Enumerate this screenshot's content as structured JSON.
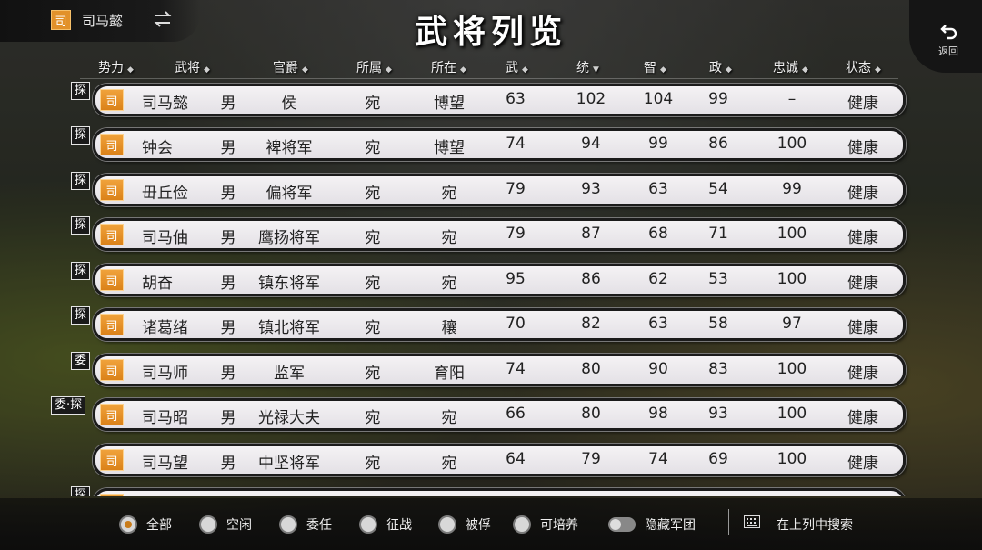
{
  "ruler": {
    "tag": "司",
    "name": "司马懿"
  },
  "title": "武将列览",
  "back_label": "返回",
  "header": {
    "columns": [
      {
        "label": "势力",
        "sort": "◆"
      },
      {
        "label": "武将",
        "sort": "◆"
      },
      {
        "label": "官爵",
        "sort": "◆"
      },
      {
        "label": "所属",
        "sort": "◆"
      },
      {
        "label": "所在",
        "sort": "◆"
      },
      {
        "label": "武",
        "sort": "◆"
      },
      {
        "label": "统",
        "sort": "▼"
      },
      {
        "label": "智",
        "sort": "◆"
      },
      {
        "label": "政",
        "sort": "◆"
      },
      {
        "label": "忠诚",
        "sort": "◆"
      },
      {
        "label": "状态",
        "sort": "◆"
      }
    ]
  },
  "rows": [
    {
      "badge": "探",
      "faction": "司",
      "name": "司马懿",
      "gender": "男",
      "rank": "侯",
      "belong": "宛",
      "location": "博望",
      "wu": "63",
      "tong": "102",
      "zhi": "104",
      "zheng": "99",
      "loyalty": "–",
      "status": "健康"
    },
    {
      "badge": "探",
      "faction": "司",
      "name": "钟会",
      "gender": "男",
      "rank": "裨将军",
      "belong": "宛",
      "location": "博望",
      "wu": "74",
      "tong": "94",
      "zhi": "99",
      "zheng": "86",
      "loyalty": "100",
      "status": "健康"
    },
    {
      "badge": "探",
      "faction": "司",
      "name": "毌丘俭",
      "gender": "男",
      "rank": "偏将军",
      "belong": "宛",
      "location": "宛",
      "wu": "79",
      "tong": "93",
      "zhi": "63",
      "zheng": "54",
      "loyalty": "99",
      "status": "健康"
    },
    {
      "badge": "探",
      "faction": "司",
      "name": "司马伷",
      "gender": "男",
      "rank": "鹰扬将军",
      "belong": "宛",
      "location": "宛",
      "wu": "79",
      "tong": "87",
      "zhi": "68",
      "zheng": "71",
      "loyalty": "100",
      "status": "健康"
    },
    {
      "badge": "探",
      "faction": "司",
      "name": "胡奋",
      "gender": "男",
      "rank": "镇东将军",
      "belong": "宛",
      "location": "宛",
      "wu": "95",
      "tong": "86",
      "zhi": "62",
      "zheng": "53",
      "loyalty": "100",
      "status": "健康"
    },
    {
      "badge": "探",
      "faction": "司",
      "name": "诸葛绪",
      "gender": "男",
      "rank": "镇北将军",
      "belong": "宛",
      "location": "穰",
      "wu": "70",
      "tong": "82",
      "zhi": "63",
      "zheng": "58",
      "loyalty": "97",
      "status": "健康"
    },
    {
      "badge": "委",
      "faction": "司",
      "name": "司马师",
      "gender": "男",
      "rank": "监军",
      "belong": "宛",
      "location": "育阳",
      "wu": "74",
      "tong": "80",
      "zhi": "90",
      "zheng": "83",
      "loyalty": "100",
      "status": "健康"
    },
    {
      "badge": "委·探",
      "faction": "司",
      "name": "司马昭",
      "gender": "男",
      "rank": "光禄大夫",
      "belong": "宛",
      "location": "宛",
      "wu": "66",
      "tong": "80",
      "zhi": "98",
      "zheng": "93",
      "loyalty": "100",
      "status": "健康"
    },
    {
      "badge": "",
      "faction": "司",
      "name": "司马望",
      "gender": "男",
      "rank": "中坚将军",
      "belong": "宛",
      "location": "宛",
      "wu": "64",
      "tong": "79",
      "zhi": "74",
      "zheng": "69",
      "loyalty": "100",
      "status": "健康"
    },
    {
      "badge": "探",
      "faction": "司",
      "name": "",
      "gender": "",
      "rank": "",
      "belong": "",
      "location": "",
      "wu": "",
      "tong": "",
      "zhi": "",
      "zheng": "",
      "loyalty": "",
      "status": ""
    }
  ],
  "filters": {
    "all": "全部",
    "idle": "空闲",
    "appoint": "委任",
    "campaign": "征战",
    "captured": "被俘",
    "trainable": "可培养",
    "hide_army": "隐藏军团",
    "search": "在上列中搜索"
  },
  "colors": {
    "accent": "#e2912a",
    "row_bg": "#efedf0",
    "badge_bg": "#1a1a1a"
  }
}
